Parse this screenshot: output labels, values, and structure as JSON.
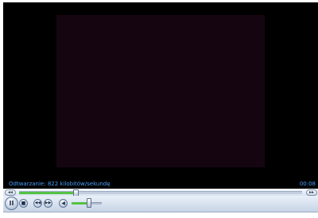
{
  "status": {
    "text": "Odtwarzanie: 822 kilobitów/sekundę",
    "time": "00:08"
  },
  "seek": {
    "progress_fraction": 0.2,
    "left_button_symbol": "◂◂",
    "right_button_symbol": "▸▸"
  },
  "controls": {
    "play_pause_symbol": "II",
    "stop_symbol": "■",
    "prev_symbol": "◀◀",
    "next_symbol": "▶▶",
    "mute_symbol": "◀",
    "volume_fraction": 0.55
  },
  "colors": {
    "video_background": "#000000",
    "video_frame": "#150511",
    "status_text": "#4a9df6",
    "progress_fill": "#54c246"
  }
}
